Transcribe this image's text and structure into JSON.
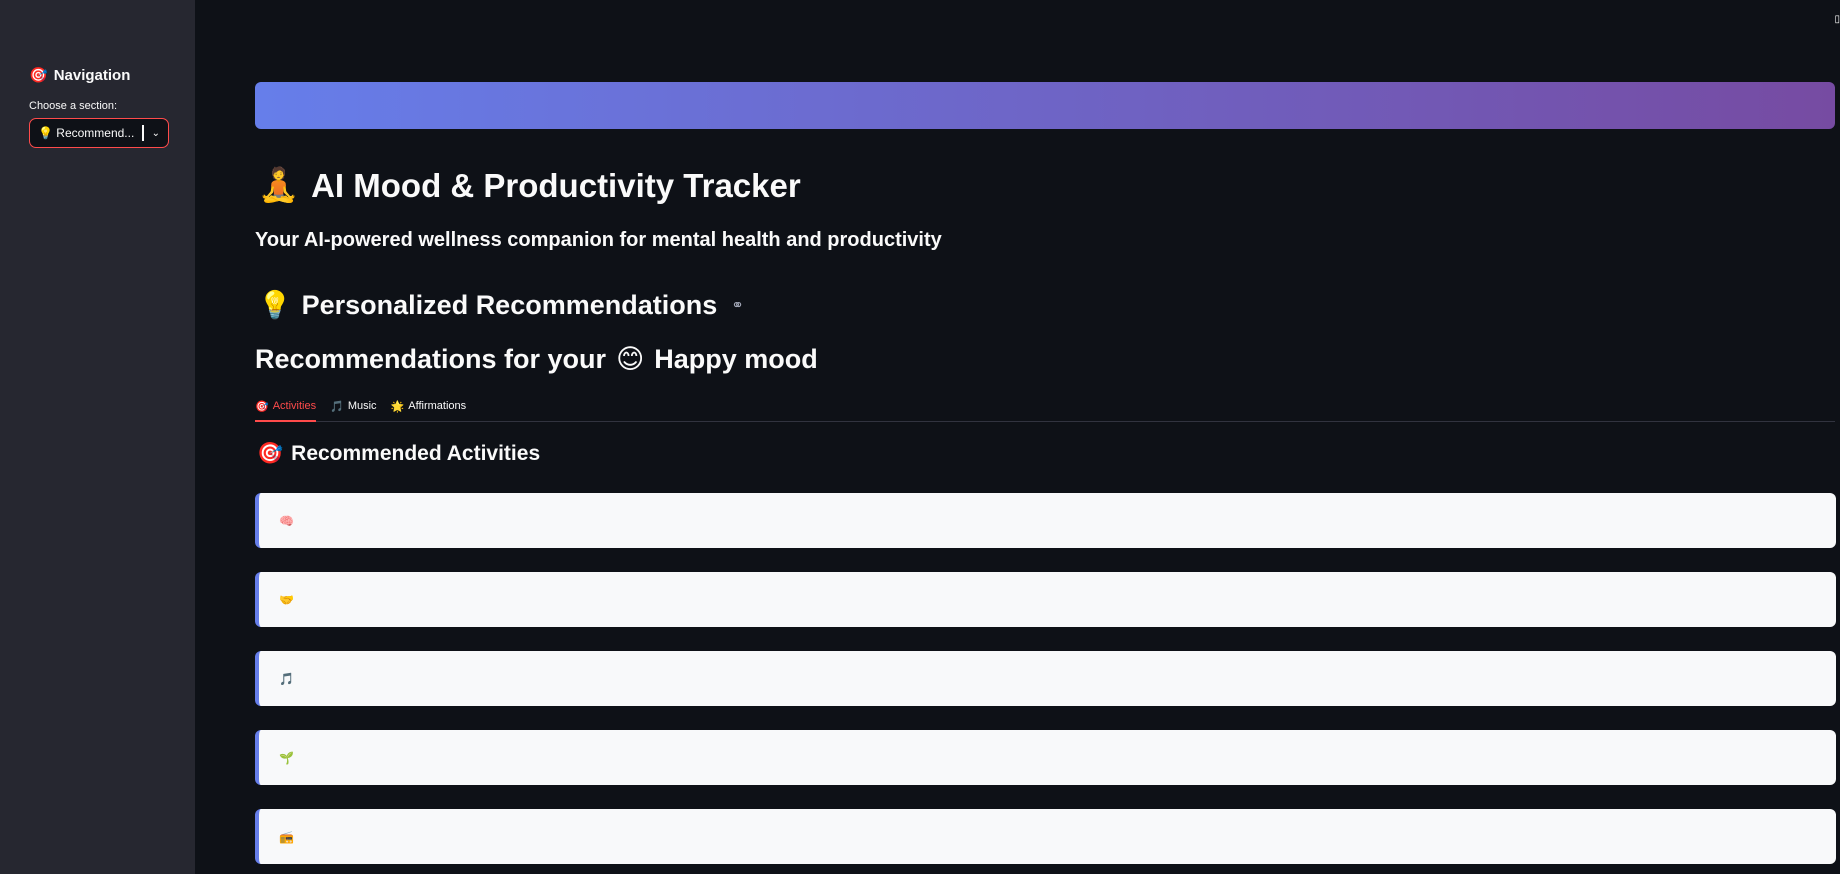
{
  "sidebar": {
    "title_icon": "🎯",
    "title": "Navigation",
    "select_label": "Choose a section:",
    "select_value": "💡 Recommend...",
    "chevron": "⌄"
  },
  "corner_glyph": "▯",
  "header": {
    "banner_gradient": [
      "#667eea",
      "#764ba2"
    ],
    "title_icon": "🧘",
    "title": "AI Mood & Productivity Tracker",
    "subtitle": "Your AI-powered wellness companion for mental health and productivity"
  },
  "section": {
    "icon": "💡",
    "title": "Personalized Recommendations",
    "link_icon": "⚭"
  },
  "recommendations": {
    "prefix": "Recommendations for your",
    "mood_icon": "😊",
    "mood": "Happy mood"
  },
  "tabs": [
    {
      "icon": "🎯",
      "label": "Activities",
      "active": true
    },
    {
      "icon": "🎵",
      "label": "Music",
      "active": false
    },
    {
      "icon": "🌟",
      "label": "Affirmations",
      "active": false
    }
  ],
  "activities": {
    "icon": "🎯",
    "title": "Recommended Activities",
    "cards": [
      {
        "icon": "🧠"
      },
      {
        "icon": "🤝"
      },
      {
        "icon": "🎵"
      },
      {
        "icon": "🌱"
      },
      {
        "icon": "📻"
      }
    ]
  },
  "colors": {
    "accent": "#ff4b4b",
    "background": "#0e1117",
    "sidebar": "#262730",
    "card": "#f8f9fa",
    "card_border": "#667eea"
  }
}
